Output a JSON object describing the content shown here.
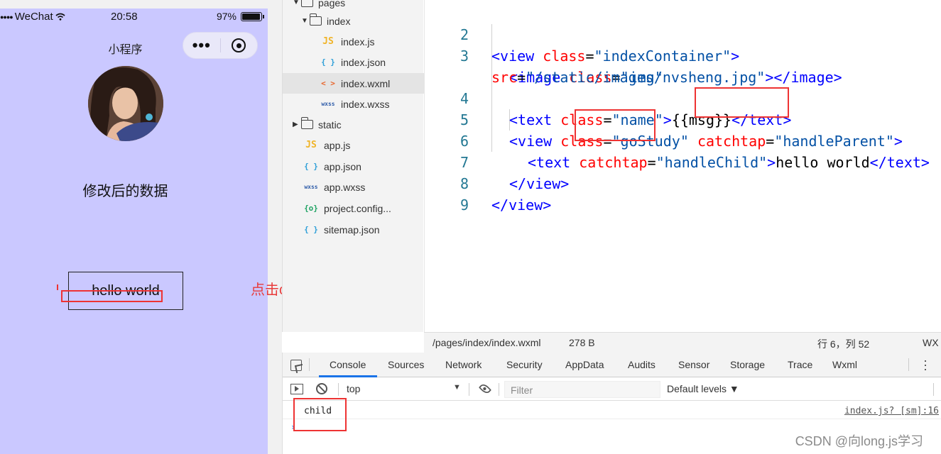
{
  "phone": {
    "status": {
      "carrier": "WeChat",
      "time": "20:58",
      "battery": "97%",
      "battery_level": 0.97
    },
    "nav_title": "小程序",
    "capsule": {
      "more_label": "•••"
    },
    "message": "修改后的数据",
    "hello_text": "hello world"
  },
  "annotation": "点击child,只会打印child",
  "tree": {
    "items": [
      {
        "label": "pages",
        "kind": "folder"
      },
      {
        "label": "index",
        "kind": "folder"
      },
      {
        "label": "index.js",
        "icon": "JS"
      },
      {
        "label": "index.json",
        "icon": "{ }"
      },
      {
        "label": "index.wxml",
        "icon": "< >"
      },
      {
        "label": "index.wxss",
        "icon": "wxss"
      },
      {
        "label": "static",
        "kind": "folder"
      },
      {
        "label": "app.js",
        "icon": "JS"
      },
      {
        "label": "app.json",
        "icon": "{ }"
      },
      {
        "label": "app.wxss",
        "icon": "wxss"
      },
      {
        "label": "project.config...",
        "icon": "{o}"
      },
      {
        "label": "sitemap.json",
        "icon": "{ }"
      }
    ]
  },
  "editor": {
    "line_numbers": [
      "2",
      "3",
      "4",
      "5",
      "6",
      "7",
      "8",
      "9"
    ],
    "l2": {
      "open": "<view ",
      "attr": "class",
      "eq": "=",
      "val": "\"indexContainer\"",
      "close": ">"
    },
    "l3": {
      "open": "<image ",
      "attr": "class",
      "eq": "=",
      "val": "\"img\""
    },
    "l3b": {
      "attr": "src",
      "eq": "=",
      "val": "\"/static/images/nvsheng.jpg\"",
      "close": "></image>"
    },
    "l4": {
      "open": "<text ",
      "attr": "class",
      "eq": "=",
      "val": "\"name\"",
      "gt": ">",
      "text": "{{msg}}",
      "close": "</text>"
    },
    "l5": {
      "open": "<view ",
      "attr": "class",
      "eq": "=",
      "val": "\"goStudy\"",
      "attr2": "catchtap",
      "eq2": "=",
      "val2": "\"handleParent\"",
      "close": ">"
    },
    "l6": {
      "open": "<text ",
      "attr": "catchtap",
      "eq": "=",
      "val": "\"handleChild\"",
      "gt": ">",
      "text": "hello world",
      "close": "</text>"
    },
    "l7": {
      "close": "</view>"
    },
    "l8": {
      "close": "</view>"
    }
  },
  "editor_status": {
    "path": "/pages/index/index.wxml",
    "size": "278 B",
    "position": "行 6，列 52",
    "lang": "WX"
  },
  "devtools": {
    "tabs": [
      "Console",
      "Sources",
      "Network",
      "Security",
      "AppData",
      "Audits",
      "Sensor",
      "Storage",
      "Trace",
      "Wxml"
    ],
    "context": "top",
    "filter_placeholder": "Filter",
    "levels": "Default levels ▼",
    "log": {
      "text": "child",
      "source": "index.js? [sm]:16"
    }
  },
  "watermark": "CSDN @向long.js学习",
  "colors": {
    "phone_bg": "#cac8ff",
    "annotation_red": "#e83b3b",
    "tag_blue": "#0000ff",
    "attr_red": "#ff0000"
  }
}
